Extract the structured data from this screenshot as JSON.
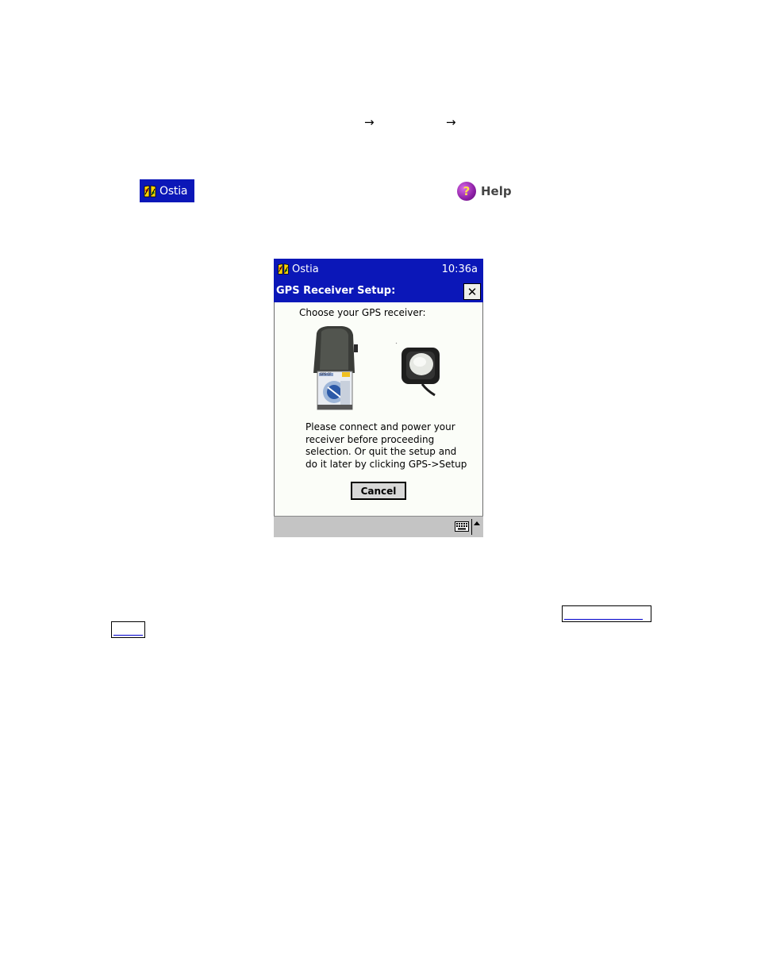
{
  "nav_arrows": [
    "→",
    "→"
  ],
  "start_chip": {
    "label": "Ostia",
    "icon": "ostia-app-icon",
    "color": "#0b17b8"
  },
  "help": {
    "label": "Help",
    "icon": "help-icon",
    "glyph": "?"
  },
  "device": {
    "titlebar": {
      "app": "Ostia",
      "time": "10:36a"
    },
    "dialog": {
      "title": "GPS Receiver Setup:",
      "close_glyph": "✕",
      "prompt": "Choose your GPS receiver:",
      "receivers": [
        {
          "name": "gps-cf-card-image",
          "card_label": "GPS-CF"
        },
        {
          "name": "gps-mouse-receiver-image"
        }
      ],
      "message_lines": [
        "Please connect and power your",
        "receiver before proceeding",
        "selection. Or quit the setup and",
        "do it later by clicking GPS->Setup"
      ],
      "cancel_label": "Cancel"
    },
    "bottom_bar": {
      "icon": "keyboard-icon"
    }
  }
}
